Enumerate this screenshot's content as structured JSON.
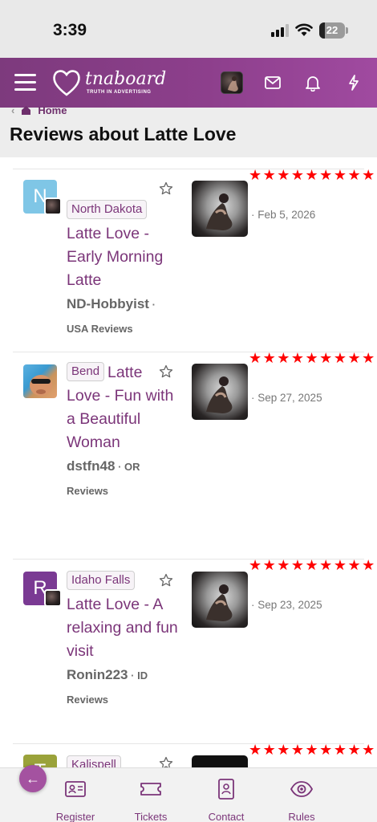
{
  "status_bar": {
    "time": "3:39",
    "battery": "22",
    "battery_level": 0.22
  },
  "header": {
    "logo_text": "tnaboard",
    "logo_tagline": "TRUTH IN ADVERTISING",
    "icons": [
      "menu-icon",
      "user-avatar",
      "mail-icon",
      "bell-icon",
      "lightning-icon"
    ]
  },
  "breadcrumb": {
    "home_label": "Home"
  },
  "page": {
    "title": "Reviews about Latte Love"
  },
  "reviews": [
    {
      "avatar_letter": "N",
      "avatar_color": "#7fc6e6",
      "location": "North Dakota",
      "title": "Latte Love - Early Morning Latte",
      "author": "ND-Hobbyist",
      "forum": "USA Reviews",
      "rating": 11,
      "stars": "★★★★★★★★★★★",
      "date": "Feb 5, 2026"
    },
    {
      "avatar_letter": "",
      "avatar_color": "#5ab0e0",
      "location": "Bend",
      "title": "Latte Love - Fun with a Beautiful Woman",
      "author": "dstfn48",
      "forum": "OR Reviews",
      "rating": 11,
      "stars": "★★★★★★★★★★★",
      "date": "Sep 27, 2025"
    },
    {
      "avatar_letter": "R",
      "avatar_color": "#7a3a93",
      "location": "Idaho Falls",
      "title": "Latte Love - A relaxing and fun visit",
      "author": "Ronin223",
      "forum": "ID Reviews",
      "rating": 11,
      "stars": "★★★★★★★★★★★",
      "date": "Sep 23, 2025"
    },
    {
      "avatar_letter": "T",
      "avatar_color": "#9aa23a",
      "location": "Kalispell",
      "title": "",
      "author": "",
      "forum": "",
      "rating": 11,
      "stars": "★★★★★★★★★★★",
      "date": ""
    }
  ],
  "bottom_nav": {
    "items": [
      {
        "label": "Register",
        "icon": "id-card-icon"
      },
      {
        "label": "Tickets",
        "icon": "ticket-icon"
      },
      {
        "label": "Contact",
        "icon": "contact-icon"
      },
      {
        "label": "Rules",
        "icon": "eye-icon"
      }
    ],
    "back_icon": "arrow-left-icon"
  },
  "colors": {
    "brand": "#8d3f8c",
    "link": "#7b3579",
    "stars": "#ff0000"
  }
}
